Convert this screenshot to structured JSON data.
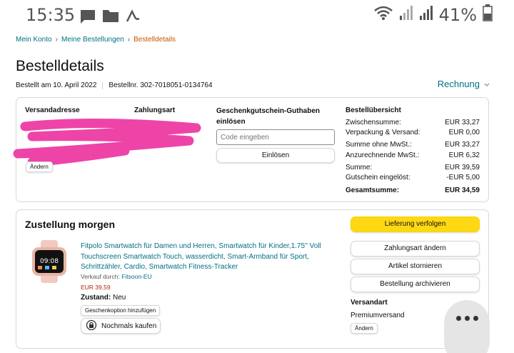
{
  "status_bar": {
    "time": "15:35",
    "battery": "41%",
    "icons": [
      "message-icon",
      "folder-icon",
      "pen-icon",
      "wifi-icon",
      "signal-icon",
      "battery-icon"
    ]
  },
  "breadcrumb": {
    "items": [
      "Mein Konto",
      "Meine Bestellungen"
    ],
    "current": "Bestelldetails",
    "separator": "›"
  },
  "page": {
    "title": "Bestelldetails",
    "ordered_on": "Bestellt am 10. April 2022",
    "order_number": "Bestellnr. 302-7018051-0134764",
    "invoice_label": "Rechnung"
  },
  "order_info": {
    "shipping_address_label": "Versandadresse",
    "payment_label": "Zahlungsart",
    "change_label": "Ändern",
    "gift_card_label": "Geschenkgutschein-Guthaben einlösen",
    "code_placeholder": "Code eingeben",
    "redeem_label": "Einlösen"
  },
  "summary": {
    "title": "Bestellübersicht",
    "rows": [
      {
        "label": "Zwischensumme:",
        "value": "EUR 33,27"
      },
      {
        "label": "Verpackung & Versand:",
        "value": "EUR 0,00"
      },
      {
        "label": "Summe ohne MwSt.:",
        "value": "EUR 33,27"
      },
      {
        "label": "Anzurechnende MwSt.:",
        "value": "EUR 6,32"
      },
      {
        "label": "Summe:",
        "value": "EUR 39,59"
      },
      {
        "label": "Gutschein eingelöst:",
        "value": "-EUR 5,00"
      }
    ],
    "total_label": "Gesamtsumme:",
    "total_value": "EUR 34,59"
  },
  "delivery": {
    "title": "Zustellung morgen",
    "product_title": "Fitpolo Smartwatch für Damen und Herren, Smartwatch für Kinder,1.75'' Voll Touchscreen Smartwatch Touch, wasserdicht, Smart-Armband für Sport, Schrittzähler, Cardio, Smartwatch Fitness-Tracker",
    "sold_by_label": "Verkauf durch:",
    "seller": "Fitsoon-EU",
    "price": "EUR 39,59",
    "condition_label": "Zustand:",
    "condition_value": "Neu",
    "gift_option_label": "Geschenkoption hinzufügen",
    "buy_again_label": "Nochmals kaufen",
    "watch_time": "09:08",
    "track_label": "Lieferung verfolgen",
    "change_payment_label": "Zahlungsart ändern",
    "cancel_label": "Artikel stornieren",
    "archive_label": "Bestellung archivieren",
    "shipping_label": "Versandart",
    "shipping_value": "Premiumversand",
    "change_label": "Ändern"
  },
  "colors": {
    "link": "#007185",
    "accent_orange": "#c45500",
    "price_red": "#b12704",
    "button_yellow": "#ffd814",
    "redaction_pink": "#ee44a8"
  }
}
